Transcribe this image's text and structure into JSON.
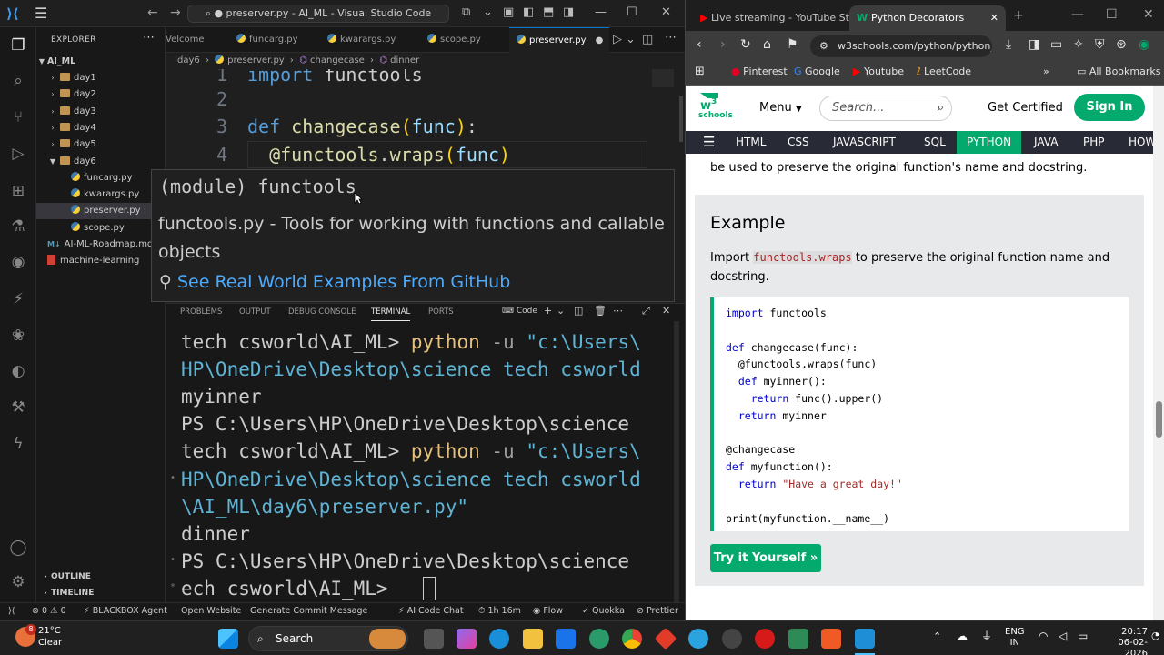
{
  "vscode": {
    "title": "● preserver.py - AI_ML - Visual Studio Code",
    "explorer": {
      "header": "EXPLORER",
      "root": "AI_ML",
      "items": [
        {
          "label": "day1",
          "type": "folder",
          "level": 1,
          "expanded": false
        },
        {
          "label": "day2",
          "type": "folder",
          "level": 1,
          "expanded": false
        },
        {
          "label": "day3",
          "type": "folder",
          "level": 1,
          "expanded": false
        },
        {
          "label": "day4",
          "type": "folder",
          "level": 1,
          "expanded": false
        },
        {
          "label": "day5",
          "type": "folder",
          "level": 1,
          "expanded": false
        },
        {
          "label": "day6",
          "type": "folder",
          "level": 1,
          "expanded": true
        },
        {
          "label": "funcarg.py",
          "type": "py",
          "level": 2
        },
        {
          "label": "kwarargs.py",
          "type": "py",
          "level": 2
        },
        {
          "label": "preserver.py",
          "type": "py",
          "level": 2,
          "selected": true
        },
        {
          "label": "scope.py",
          "type": "py",
          "level": 2
        },
        {
          "label": "AI-ML-Roadmap.md",
          "type": "md",
          "level": 1
        },
        {
          "label": "machine-learning",
          "type": "pdf",
          "level": 1
        }
      ],
      "outline": "OUTLINE",
      "timeline": "TIMELINE"
    },
    "tabs": [
      {
        "label": "Velcome"
      },
      {
        "label": "funcarg.py"
      },
      {
        "label": "kwarargs.py"
      },
      {
        "label": "scope.py"
      },
      {
        "label": "preserver.py",
        "active": true
      }
    ],
    "breadcrumb": [
      "day6",
      "preserver.py",
      "changecase",
      "dinner"
    ],
    "code_lines": [
      {
        "num": "1",
        "parts": [
          [
            "kw",
            "import"
          ],
          [
            "op",
            " functools"
          ]
        ]
      },
      {
        "num": "2",
        "parts": []
      },
      {
        "num": "3",
        "parts": [
          [
            "kw",
            "def"
          ],
          [
            "op",
            " "
          ],
          [
            "fn",
            "changecase"
          ],
          [
            "br",
            "("
          ],
          [
            "pm",
            "func"
          ],
          [
            "br",
            ")"
          ],
          [
            "op",
            ":"
          ]
        ]
      },
      {
        "num": "4",
        "parts": [
          [
            "op",
            "  "
          ],
          [
            "dec",
            "@functools"
          ],
          [
            "op",
            "."
          ],
          [
            "fn",
            "wraps"
          ],
          [
            "br",
            "("
          ],
          [
            "pm",
            "func"
          ],
          [
            "br",
            ")"
          ]
        ]
      }
    ],
    "hover": {
      "signature": "(module) functools",
      "description": "functools.py - Tools for working with functions and callable objects",
      "link": "See Real World Examples From GitHub"
    },
    "panel_tabs": [
      "PROBLEMS",
      "OUTPUT",
      "DEBUG CONSOLE",
      "TERMINAL",
      "PORTS"
    ],
    "panel_active": "TERMINAL",
    "terminal_profile": "Code",
    "terminal_lines": [
      {
        "dot": "",
        "parts": [
          [
            "",
            "tech csworld\\AI_ML> "
          ],
          [
            "t-py",
            "python"
          ],
          [
            "t-flag",
            " -u "
          ],
          [
            "t-str",
            "\"c:\\Users\\"
          ]
        ]
      },
      {
        "dot": "",
        "parts": [
          [
            "t-str",
            "HP\\OneDrive\\Desktop\\science tech csworld"
          ]
        ]
      },
      {
        "dot": "",
        "parts": [
          [
            "",
            "myinner"
          ]
        ]
      },
      {
        "dot": "",
        "parts": [
          [
            "",
            "PS C:\\Users\\HP\\OneDrive\\Desktop\\science"
          ]
        ]
      },
      {
        "dot": "",
        "parts": [
          [
            "",
            "tech csworld\\AI_ML> "
          ],
          [
            "t-py",
            "python"
          ],
          [
            "t-flag",
            " -u "
          ],
          [
            "t-str",
            "\"c:\\Users\\"
          ]
        ]
      },
      {
        "dot": "•",
        "parts": [
          [
            "t-str",
            "HP\\OneDrive\\Desktop\\science tech csworld"
          ]
        ]
      },
      {
        "dot": "",
        "parts": [
          [
            "t-str",
            "\\AI_ML\\day6\\preserver.py\""
          ]
        ]
      },
      {
        "dot": "",
        "parts": [
          [
            "",
            "dinner"
          ]
        ]
      },
      {
        "dot": "•",
        "parts": [
          [
            "",
            "PS C:\\Users\\HP\\OneDrive\\Desktop\\science"
          ]
        ]
      },
      {
        "dot": "*",
        "parts": [
          [
            "",
            "ech csworld\\AI_ML> "
          ]
        ]
      }
    ],
    "status": {
      "errors": "0",
      "warnings": "0",
      "blackbox": "BLACKBOX Agent",
      "open_website": "Open Website",
      "commit": "Generate Commit Message",
      "ai_chat": "AI Code Chat",
      "time": "1h 16m",
      "flow": "Flow",
      "quokka": "Quokka",
      "prettier": "Prettier"
    }
  },
  "browser": {
    "tabs": [
      {
        "label": "Live streaming - YouTube Stu"
      },
      {
        "label": "Python Decorators",
        "active": true
      }
    ],
    "url": "w3schools.com/python/python_d",
    "bookmarks": [
      "Pinterest",
      "Google",
      "Youtube",
      "LeetCode",
      "All Bookmarks"
    ],
    "w3": {
      "menu": "Menu",
      "search_placeholder": "Search...",
      "get_certified": "Get Certified",
      "sign_in": "Sign In",
      "logo_text": "schools",
      "nav": [
        "HTML",
        "CSS",
        "JAVASCRIPT",
        "SQL",
        "PYTHON",
        "JAVA",
        "PHP",
        "HOW"
      ],
      "nav_active": "PYTHON",
      "intro": "be used to preserve the original function's name and docstring.",
      "example_title": "Example",
      "example_desc_pre": "Import ",
      "example_desc_code": "functools.wraps",
      "example_desc_post": " to preserve the original function name and docstring.",
      "code": [
        "import functools",
        "",
        "def changecase(func):",
        "  @functools.wraps(func)",
        "  def myinner():",
        "    return func().upper()",
        "  return myinner",
        "",
        "@changecase",
        "def myfunction():",
        "  return \"Have a great day!\"",
        "",
        "print(myfunction.__name__)"
      ],
      "try_it": "Try it Yourself »"
    }
  },
  "taskbar": {
    "temperature": "21°C",
    "condition": "Clear",
    "weather_badge": "8",
    "search": "Search",
    "lang": "ENG",
    "region": "IN",
    "time": "20:17",
    "date": "06-02-2026"
  }
}
